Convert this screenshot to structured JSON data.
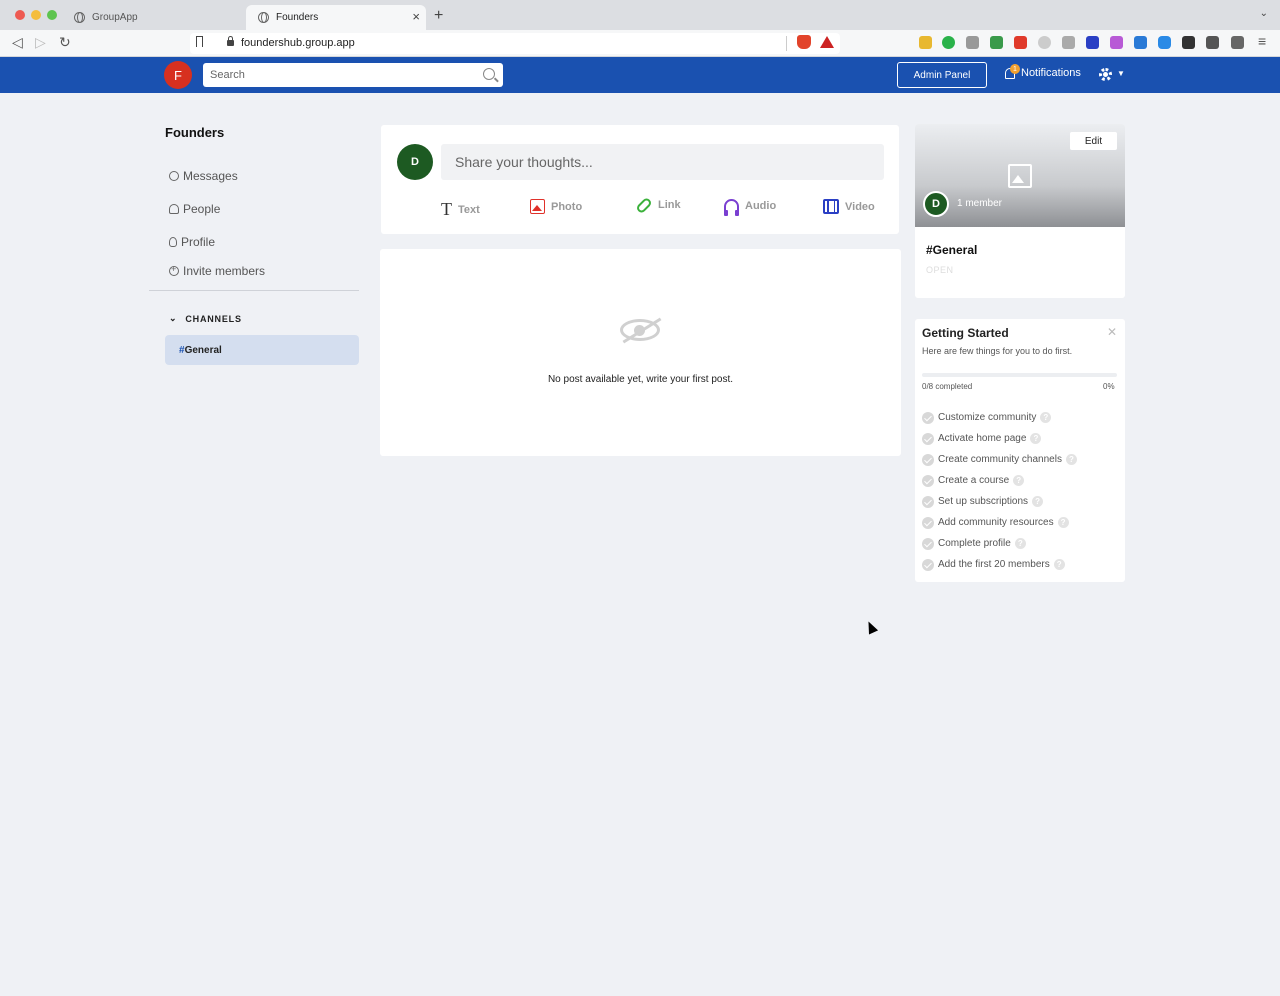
{
  "browser": {
    "tabs": [
      {
        "title": "GroupApp",
        "active": false
      },
      {
        "title": "Founders",
        "active": true
      }
    ],
    "url": "foundershub.group.app"
  },
  "header": {
    "avatar_initial": "F",
    "search_placeholder": "Search",
    "admin_panel_label": "Admin Panel",
    "notifications_label": "Notifications",
    "notifications_count": "1",
    "brand_color": "#1a51b0"
  },
  "sidebar": {
    "community_title": "Founders",
    "items": [
      {
        "label": "Messages",
        "icon": "chat-icon"
      },
      {
        "label": "People",
        "icon": "people-icon"
      },
      {
        "label": "Profile",
        "icon": "user-icon"
      },
      {
        "label": "Invite members",
        "icon": "plus-circle-icon"
      }
    ],
    "channels_heading": "CHANNELS",
    "channels": [
      {
        "hash": "#",
        "name": "General",
        "selected": true
      }
    ]
  },
  "composer": {
    "avatar_initial": "D",
    "placeholder": "Share your thoughts...",
    "post_types": [
      {
        "label": "Text",
        "icon": "text-icon"
      },
      {
        "label": "Photo",
        "icon": "photo-icon"
      },
      {
        "label": "Link",
        "icon": "link-icon"
      },
      {
        "label": "Audio",
        "icon": "headphones-icon"
      },
      {
        "label": "Video",
        "icon": "film-icon"
      }
    ]
  },
  "feed": {
    "empty_message": "No post available yet, write your first post."
  },
  "channel_card": {
    "edit_label": "Edit",
    "avatar_initial": "D",
    "member_count": "1 member",
    "name": "#General",
    "status": "OPEN"
  },
  "getting_started": {
    "title": "Getting Started",
    "subtitle": "Here are few things for you to do first.",
    "progress_label": "0/8 completed",
    "progress_percent": "0%",
    "progress_fraction": 0,
    "tasks": [
      "Customize community",
      "Activate home page",
      "Create community channels",
      "Create a course",
      "Set up subscriptions",
      "Add community resources",
      "Complete profile",
      "Add the first 20 members"
    ]
  }
}
